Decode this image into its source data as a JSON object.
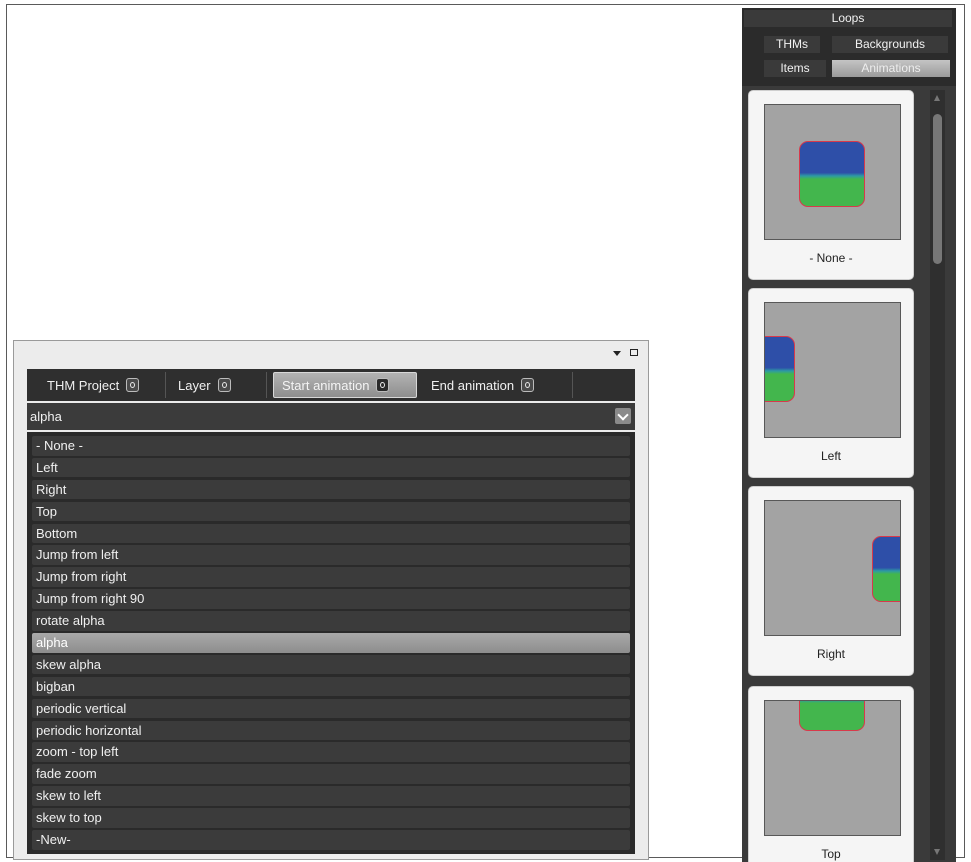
{
  "left_panel": {
    "tabs": [
      {
        "label": "THM Project",
        "icon": "gear-icon"
      },
      {
        "label": "Layer",
        "icon": "gear-icon"
      },
      {
        "label": "Start animation",
        "icon": "gear-icon"
      },
      {
        "label": "End animation",
        "icon": "gear-icon"
      }
    ],
    "active_tab": "Start animation",
    "combo_value": "alpha",
    "animation_list": [
      "- None -",
      "Left",
      "Right",
      "Top",
      "Bottom",
      "Jump from left",
      "Jump from right",
      "Jump from right 90",
      "rotate alpha",
      "alpha",
      "skew alpha",
      "bigban",
      "periodic vertical",
      "periodic horizontal",
      "zoom - top left",
      "fade zoom",
      "skew to left",
      "skew to top",
      "-New-"
    ],
    "selected_item": "alpha"
  },
  "right_panel": {
    "tabs": {
      "loops": "Loops",
      "thms": "THMs",
      "backgrounds": "Backgrounds",
      "items": "Items",
      "animations": "Animations"
    },
    "active_tab": "Animations",
    "thumbnails": [
      {
        "label": "- None -"
      },
      {
        "label": "Left"
      },
      {
        "label": "Right"
      },
      {
        "label": "Top"
      }
    ]
  },
  "colors": {
    "clip_blue": "#2e4fa8",
    "clip_green": "#43b64d",
    "clip_border": "#d8394b",
    "preview_bg": "#a3a3a3",
    "panel_dark": "#2a2a2a"
  }
}
